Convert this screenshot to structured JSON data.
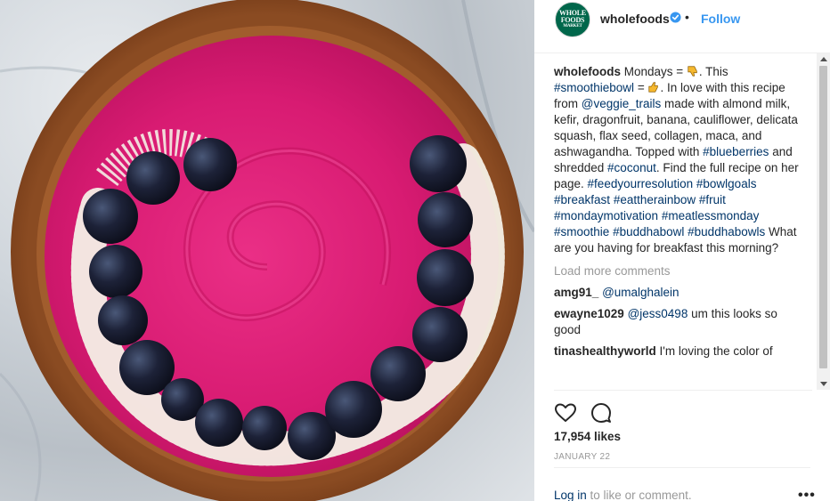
{
  "post": {
    "image_alt": "Pink smoothie bowl with blueberries and shredded coconut"
  },
  "header": {
    "avatar_lines": [
      "WHOLE",
      "FOODS",
      "MARKET"
    ],
    "username": "wholefoods",
    "separator": "•",
    "follow_label": "Follow"
  },
  "caption": {
    "username": "wholefoods",
    "t1": " Mondays = ",
    "t2": ". This ",
    "tag_smoothiebowl": "#smoothiebowl",
    "t3": " = ",
    "t4": ". In love with this recipe from ",
    "mention": "@veggie_trails",
    "t5": " made with almond milk, kefir, dragonfruit, banana, cauliflower, delicata squash, flax seed, collagen, maca, and ashwagandha. Topped with ",
    "tag_blueberries": "#blueberries",
    "t6": " and shredded ",
    "tag_coconut": "#coconut",
    "t7": ". Find the full recipe on her page. ",
    "tags": [
      "#feedyourresolution",
      "#bowlgoals",
      "#breakfast",
      "#eattherainbow",
      "#fruit",
      "#mondaymotivation",
      "#meatlessmonday",
      "#smoothie",
      "#buddhabowl",
      "#buddhabowls"
    ],
    "question": " What are you having for breakfast this morning?"
  },
  "load_more": "Load more comments",
  "comments": [
    {
      "user": "amg91_",
      "mention": "@umalghalein",
      "text": ""
    },
    {
      "user": "ewayne1029",
      "mention": "@jess0498",
      "text": " um this looks so good"
    },
    {
      "user": "tinashealthyworld",
      "mention": "",
      "text": " I'm loving the color of"
    }
  ],
  "likes": "17,954 likes",
  "date": "JANUARY 22",
  "footer": {
    "login_link": "Log in",
    "login_rest": " to like or comment.",
    "more": "•••"
  },
  "colors": {
    "link": "#003569",
    "follow": "#3897f0",
    "muted": "#999999",
    "brand_green": "#00674b",
    "smoothie": "#e0217a"
  },
  "icons": [
    "verified-badge-icon",
    "thumbs-down-emoji-icon",
    "thumbs-up-emoji-icon",
    "heart-icon",
    "comment-icon",
    "more-options-icon"
  ]
}
